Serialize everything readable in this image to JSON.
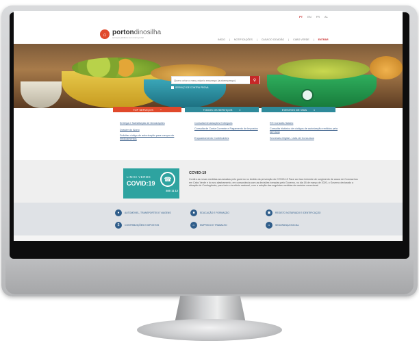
{
  "header": {
    "languages": [
      "PT",
      "EN",
      "FR",
      "AL"
    ],
    "logo_bold": "porton",
    "logo_light": "dinosilha",
    "logo_tagline": "serviços públicos num único portal",
    "nav": [
      "INÍCIO",
      "NOTIFICAÇÕES",
      "CASA DO CIDADÃO",
      "CABO VERDE",
      "ENTRAR"
    ]
  },
  "search": {
    "placeholder": "Quero criar o meu próprio emprego (autoemprego)",
    "button_icon": "search-icon",
    "option_label": "SERVIÇO DE CONTRA PROVA"
  },
  "tabs": {
    "top": "TOP SERVIÇOS",
    "all": "TODOS OS SERVIÇOS",
    "life": "EVENTOS DE VIDA"
  },
  "services": {
    "col1": [
      "Entrega e Substituição de Declarações",
      "Dossier do Aluno",
      "Solicitar código de autorização para compra de medicamentos"
    ],
    "col2": [
      "Consulta Declarações Entregues",
      "Consulta de Conta Corrente e Pagamento de Impostos",
      "Enquadramento Contribuintes"
    ],
    "col3": [
      "RH Consulta Salário",
      "Consulta histórico de códigos de autorização emitidos pela farmácia",
      "Secretaria Digital - Lista de Concursos"
    ]
  },
  "covid": {
    "badge_line1": "LINHA VERDE",
    "badge_line2": "COVID:19",
    "badge_number": "800 11 12",
    "title": "COVID-19",
    "text": "Confira as novas medidas anunciadas pelo governo no âmbito da prevenção do COVID-19 Face ao risco iminente de surgimento de casos de Coronavírus em Cabo Verde e do seu alastramento, em consonância com as decisões tomadas pelo Governo, no dia 18 de março de 2020, o Governo declarado a situação de Contingência, para todo o território nacional, com a adoção das seguintes medidas de carácter excecional."
  },
  "categories": [
    {
      "label": "AUTOMÓVEL, TRANSPORTES E VIAGENS",
      "icon": "car-icon"
    },
    {
      "label": "EDUCAÇÃO E FORMAÇÃO",
      "icon": "graduation-icon"
    },
    {
      "label": "REGISTO NOTARIADO E IDENTIFICAÇÃO",
      "icon": "id-card-icon"
    },
    {
      "label": "CONTRIBUIÇÕES E IMPOSTOS",
      "icon": "dollar-icon"
    },
    {
      "label": "EMPREGO E TRABALHO",
      "icon": "home-icon"
    },
    {
      "label": "SEGURANÇA SOCIAL",
      "icon": "home-icon"
    }
  ],
  "colors": {
    "brand_red": "#c62828",
    "tab_top": "#e0492b",
    "tab_teal": "#2e8a9a",
    "link": "#3b5f8a",
    "covid_green": "#2ea3a0"
  }
}
